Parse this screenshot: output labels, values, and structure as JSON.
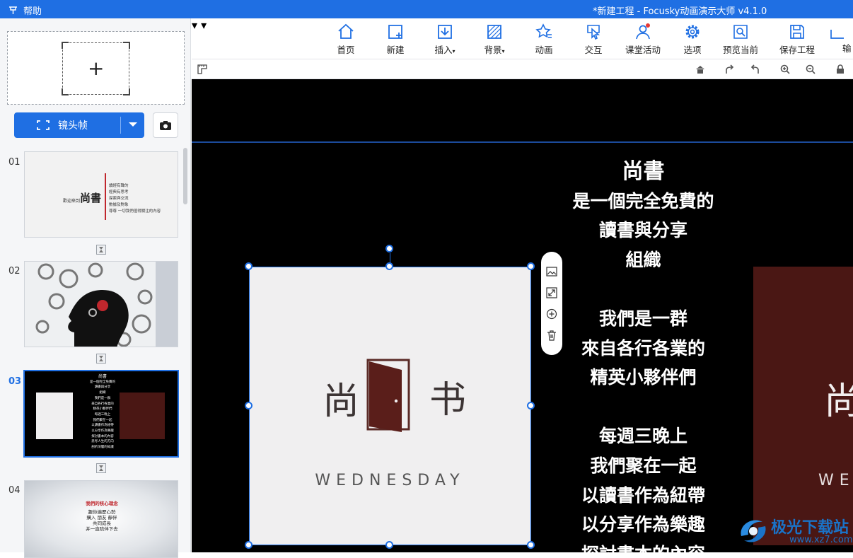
{
  "titlebar": {
    "help_menu": "帮助",
    "title": "*新建工程 - Focusky动画演示大师  v4.1.0"
  },
  "sidebar": {
    "frame_button_label": "镜头帧",
    "slides": [
      {
        "num": "01",
        "title": "尚書",
        "subtitle": "歡迎來到",
        "lines": [
          "讀經有聲的",
          "經典有思考",
          "探索與交流",
          "數據及對象",
          "尊尊 一切我們值得關注的內容"
        ]
      },
      {
        "num": "02"
      },
      {
        "num": "03",
        "lines": [
          "尚書",
          "是一個完全免費的",
          "讀書與分享",
          "組織",
          "我們是一群",
          "來自各行各業的",
          "精英小夥伴們",
          "每週三晚上",
          "我們聚在一起",
          "以讀書作為紐帶",
          "以分享作為樂趣",
          "探討書本的內容",
          "思考人生的方向",
          "剖析深層的知識"
        ]
      },
      {
        "num": "04",
        "title": "我們的核心理念",
        "lines": [
          "趣你遍歷心勢",
          "購入 朋友 靜伴",
          "共同成長",
          "并一直陪伴下去"
        ]
      }
    ]
  },
  "toolbar": {
    "items": [
      {
        "label": "首页",
        "icon": "home-icon"
      },
      {
        "label": "新建",
        "icon": "new-frame-icon"
      },
      {
        "label": "插入",
        "icon": "insert-icon",
        "dropdown": true
      },
      {
        "label": "背景",
        "icon": "background-icon",
        "dropdown": true
      },
      {
        "label": "动画",
        "icon": "animation-star-icon"
      },
      {
        "label": "交互",
        "icon": "interaction-icon"
      },
      {
        "label": "课堂活动",
        "icon": "classroom-icon"
      },
      {
        "label": "选项",
        "icon": "gear-icon"
      },
      {
        "label": "预览当前",
        "icon": "preview-icon",
        "dropdown": true
      },
      {
        "label": "保存工程",
        "icon": "save-icon",
        "dropdown": true
      },
      {
        "label": "输",
        "icon": "export-icon"
      }
    ]
  },
  "canvas": {
    "title": "尚書",
    "text_lines": [
      "是一個完全免費的",
      "讀書與分享",
      "組織",
      "",
      "我們是一群",
      "來自各行各業的",
      "精英小夥伴們",
      "",
      "每週三晚上",
      "我們聚在一起",
      "以讀書作為紐帶",
      "以分享作為樂趣",
      "探討書本的內容"
    ],
    "logo": {
      "char_left": "尚",
      "char_right": "书",
      "word": "WEDNESDAY"
    },
    "right_logo": {
      "char": "尚",
      "word": "WE"
    }
  },
  "watermark": {
    "line1": "极光下载站",
    "line2": "www.xz7.com"
  }
}
